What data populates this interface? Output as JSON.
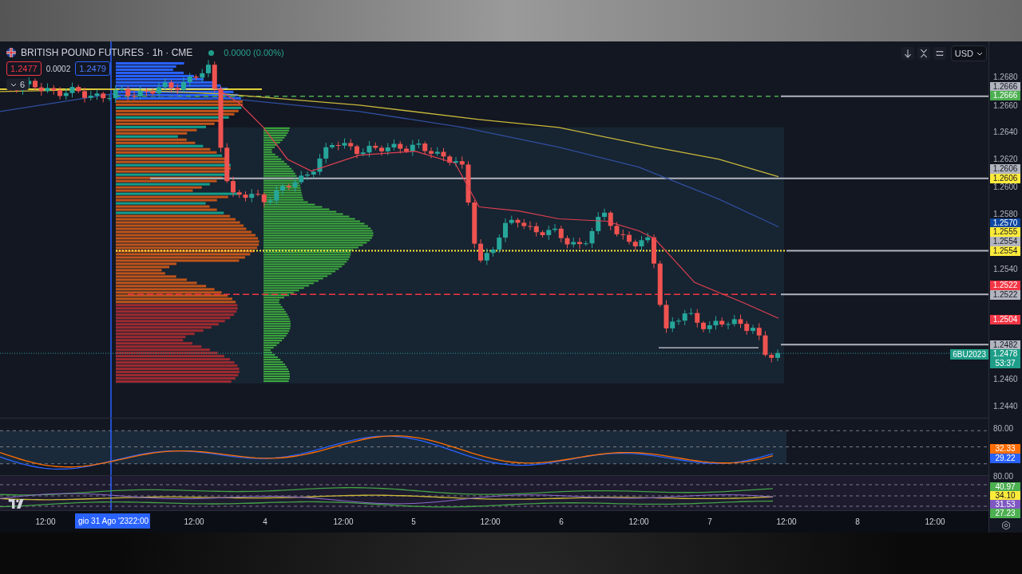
{
  "header": {
    "symbol": "BRITISH POUND FUTURES · 1h · CME",
    "change": "0.0000 (0.00%)",
    "sell_price": "1.2477",
    "spread": "0.0002",
    "buy_price": "1.2479",
    "indicators_count": "6"
  },
  "toolbar": {
    "currency": "USD"
  },
  "price_axis": {
    "ticks": [
      "1.2680",
      "1.2660",
      "1.2640",
      "1.2620",
      "1.2600",
      "1.2580",
      "1.2540",
      "1.2460",
      "1.2440"
    ],
    "tags": [
      {
        "text": "1.2666",
        "color": "#b2b5be"
      },
      {
        "text": "1.2666",
        "color": "#4caf50"
      },
      {
        "text": "1.2606",
        "color": "#b2b5be"
      },
      {
        "text": "1.2606",
        "color": "#ffeb3b"
      },
      {
        "text": "1.2570",
        "color": "#0d47a1"
      },
      {
        "text": "1.2555",
        "color": "#ffeb3b"
      },
      {
        "text": "1.2554",
        "color": "#b2b5be"
      },
      {
        "text": "1.2554",
        "color": "#ffeb3b"
      },
      {
        "text": "1.2522",
        "color": "#f23645"
      },
      {
        "text": "1.2522",
        "color": "#b2b5be"
      },
      {
        "text": "1.2504",
        "color": "#f23645"
      },
      {
        "text": "1.2482",
        "color": "#b2b5be"
      }
    ]
  },
  "last_price": {
    "symbol_tag": "6BU2023",
    "price": "1.2478",
    "countdown": "53:37"
  },
  "oscillator_1": {
    "axis_label": "80.00",
    "tags": [
      {
        "text": "32.33",
        "color": "#ff6d00"
      },
      {
        "text": "29.22",
        "color": "#2962ff"
      }
    ]
  },
  "oscillator_2": {
    "axis_label": "80.00",
    "tags": [
      {
        "text": "40.97",
        "color": "#4caf50"
      },
      {
        "text": "34.10",
        "color": "#ffeb3b"
      },
      {
        "text": "31.53",
        "color": "#7e57c2"
      },
      {
        "text": "27.23",
        "color": "#4caf50"
      }
    ]
  },
  "time_axis": {
    "labels": [
      "12:00",
      "12:00",
      "4",
      "12:00",
      "5",
      "12:00",
      "6",
      "12:00",
      "7",
      "12:00",
      "8",
      "12:00"
    ],
    "cursor_date": "gio 31 Ago '23",
    "cursor_time": "22:00"
  }
}
